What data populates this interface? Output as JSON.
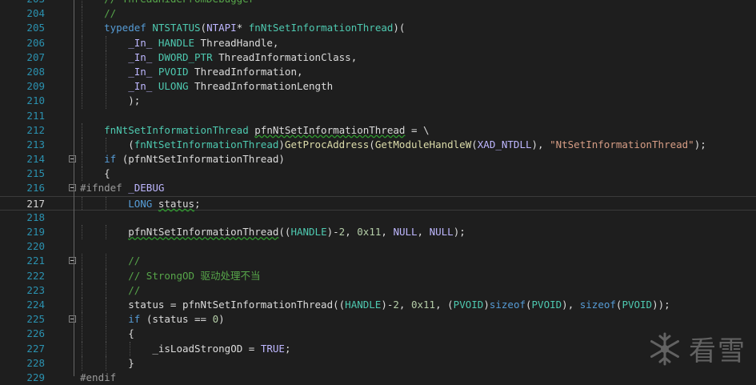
{
  "editor": {
    "current_line": "217",
    "lines": [
      {
        "num": "203",
        "fold": false,
        "indent": 28,
        "segments": [
          {
            "cls": "c",
            "text": "// ThreadHideFromDebugger"
          }
        ]
      },
      {
        "num": "204",
        "fold": false,
        "indent": 28,
        "segments": [
          {
            "cls": "c",
            "text": "//"
          }
        ]
      },
      {
        "num": "205",
        "fold": false,
        "indent": 28,
        "segments": [
          {
            "cls": "k",
            "text": "typedef"
          },
          {
            "cls": "",
            "text": " "
          },
          {
            "cls": "t",
            "text": "NTSTATUS"
          },
          {
            "cls": "",
            "text": "("
          },
          {
            "cls": "m",
            "text": "NTAPI"
          },
          {
            "cls": "",
            "text": "* "
          },
          {
            "cls": "t",
            "text": "fnNtSetInformationThread"
          },
          {
            "cls": "",
            "text": ")("
          }
        ]
      },
      {
        "num": "206",
        "fold": false,
        "indent": 56,
        "segments": [
          {
            "cls": "m",
            "text": "_In_"
          },
          {
            "cls": "",
            "text": " "
          },
          {
            "cls": "t",
            "text": "HANDLE"
          },
          {
            "cls": "",
            "text": " ThreadHandle,"
          }
        ]
      },
      {
        "num": "207",
        "fold": false,
        "indent": 56,
        "segments": [
          {
            "cls": "m",
            "text": "_In_"
          },
          {
            "cls": "",
            "text": " "
          },
          {
            "cls": "t",
            "text": "DWORD_PTR"
          },
          {
            "cls": "",
            "text": " ThreadInformationClass,"
          }
        ]
      },
      {
        "num": "208",
        "fold": false,
        "indent": 56,
        "segments": [
          {
            "cls": "m",
            "text": "_In_"
          },
          {
            "cls": "",
            "text": " "
          },
          {
            "cls": "t",
            "text": "PVOID"
          },
          {
            "cls": "",
            "text": " ThreadInformation,"
          }
        ]
      },
      {
        "num": "209",
        "fold": false,
        "indent": 56,
        "segments": [
          {
            "cls": "m",
            "text": "_In_"
          },
          {
            "cls": "",
            "text": " "
          },
          {
            "cls": "t",
            "text": "ULONG"
          },
          {
            "cls": "",
            "text": " ThreadInformationLength"
          }
        ]
      },
      {
        "num": "210",
        "fold": false,
        "indent": 56,
        "segments": [
          {
            "cls": "",
            "text": ");"
          }
        ]
      },
      {
        "num": "211",
        "fold": false,
        "indent": 0,
        "segments": []
      },
      {
        "num": "212",
        "fold": false,
        "indent": 28,
        "segments": [
          {
            "cls": "t",
            "text": "fnNtSetInformationThread"
          },
          {
            "cls": "",
            "text": " "
          },
          {
            "cls": "v sq",
            "text": "pfnNtSetInformationThread"
          },
          {
            "cls": "",
            "text": " = \\"
          }
        ]
      },
      {
        "num": "213",
        "fold": false,
        "indent": 56,
        "segments": [
          {
            "cls": "",
            "text": "("
          },
          {
            "cls": "t",
            "text": "fnNtSetInformationThread"
          },
          {
            "cls": "",
            "text": ")"
          },
          {
            "cls": "f",
            "text": "GetProcAddress"
          },
          {
            "cls": "",
            "text": "("
          },
          {
            "cls": "f",
            "text": "GetModuleHandleW"
          },
          {
            "cls": "",
            "text": "("
          },
          {
            "cls": "m",
            "text": "XAD_NTDLL"
          },
          {
            "cls": "",
            "text": "), "
          },
          {
            "cls": "s",
            "text": "\"NtSetInformationThread\""
          },
          {
            "cls": "",
            "text": ");"
          }
        ]
      },
      {
        "num": "214",
        "fold": true,
        "indent": 28,
        "segments": [
          {
            "cls": "k",
            "text": "if"
          },
          {
            "cls": "",
            "text": " (pfnNtSetInformationThread)"
          }
        ]
      },
      {
        "num": "215",
        "fold": false,
        "indent": 28,
        "segments": [
          {
            "cls": "",
            "text": "{"
          }
        ]
      },
      {
        "num": "216",
        "fold": true,
        "indent": 0,
        "segments": [
          {
            "cls": "pp",
            "text": "#ifndef"
          },
          {
            "cls": "",
            "text": " "
          },
          {
            "cls": "m",
            "text": "_DEBUG"
          }
        ]
      },
      {
        "num": "217",
        "fold": false,
        "indent": 56,
        "segments": [
          {
            "cls": "k",
            "text": "LONG"
          },
          {
            "cls": "",
            "text": " "
          },
          {
            "cls": "v sq",
            "text": "status"
          },
          {
            "cls": "",
            "text": ";"
          }
        ]
      },
      {
        "num": "218",
        "fold": false,
        "indent": 0,
        "segments": []
      },
      {
        "num": "219",
        "fold": false,
        "indent": 56,
        "segments": [
          {
            "cls": "v sq",
            "text": "pfnNtSetInformationThread"
          },
          {
            "cls": "",
            "text": "(("
          },
          {
            "cls": "t",
            "text": "HANDLE"
          },
          {
            "cls": "",
            "text": ")-"
          },
          {
            "cls": "n",
            "text": "2"
          },
          {
            "cls": "",
            "text": ", "
          },
          {
            "cls": "n",
            "text": "0x11"
          },
          {
            "cls": "",
            "text": ", "
          },
          {
            "cls": "m",
            "text": "NULL"
          },
          {
            "cls": "",
            "text": ", "
          },
          {
            "cls": "m",
            "text": "NULL"
          },
          {
            "cls": "",
            "text": ");"
          }
        ]
      },
      {
        "num": "220",
        "fold": false,
        "indent": 0,
        "segments": []
      },
      {
        "num": "221",
        "fold": true,
        "indent": 56,
        "segments": [
          {
            "cls": "c",
            "text": "//"
          }
        ]
      },
      {
        "num": "222",
        "fold": false,
        "indent": 56,
        "segments": [
          {
            "cls": "c",
            "text": "// StrongOD 驱动处理不当"
          }
        ]
      },
      {
        "num": "223",
        "fold": false,
        "indent": 56,
        "segments": [
          {
            "cls": "c",
            "text": "//"
          }
        ]
      },
      {
        "num": "224",
        "fold": false,
        "indent": 56,
        "segments": [
          {
            "cls": "",
            "text": "status = pfnNtSetInformationThread(("
          },
          {
            "cls": "t",
            "text": "HANDLE"
          },
          {
            "cls": "",
            "text": ")-"
          },
          {
            "cls": "n",
            "text": "2"
          },
          {
            "cls": "",
            "text": ", "
          },
          {
            "cls": "n",
            "text": "0x11"
          },
          {
            "cls": "",
            "text": ", ("
          },
          {
            "cls": "t",
            "text": "PVOID"
          },
          {
            "cls": "",
            "text": ")"
          },
          {
            "cls": "k",
            "text": "sizeof"
          },
          {
            "cls": "",
            "text": "("
          },
          {
            "cls": "t",
            "text": "PVOID"
          },
          {
            "cls": "",
            "text": "), "
          },
          {
            "cls": "k",
            "text": "sizeof"
          },
          {
            "cls": "",
            "text": "("
          },
          {
            "cls": "t",
            "text": "PVOID"
          },
          {
            "cls": "",
            "text": "));"
          }
        ]
      },
      {
        "num": "225",
        "fold": true,
        "indent": 56,
        "segments": [
          {
            "cls": "k",
            "text": "if"
          },
          {
            "cls": "",
            "text": " (status == "
          },
          {
            "cls": "n",
            "text": "0"
          },
          {
            "cls": "",
            "text": ")"
          }
        ]
      },
      {
        "num": "226",
        "fold": false,
        "indent": 56,
        "segments": [
          {
            "cls": "",
            "text": "{"
          }
        ]
      },
      {
        "num": "227",
        "fold": false,
        "indent": 84,
        "segments": [
          {
            "cls": "",
            "text": "_isLoadStrongOD = "
          },
          {
            "cls": "m",
            "text": "TRUE"
          },
          {
            "cls": "",
            "text": ";"
          }
        ]
      },
      {
        "num": "228",
        "fold": false,
        "indent": 56,
        "segments": [
          {
            "cls": "",
            "text": "}"
          }
        ]
      },
      {
        "num": "229",
        "fold": false,
        "indent": 0,
        "segments": [
          {
            "cls": "pp",
            "text": "#endif"
          }
        ]
      }
    ]
  },
  "watermark": {
    "text": "看雪",
    "icon": "snowflake-icon"
  }
}
